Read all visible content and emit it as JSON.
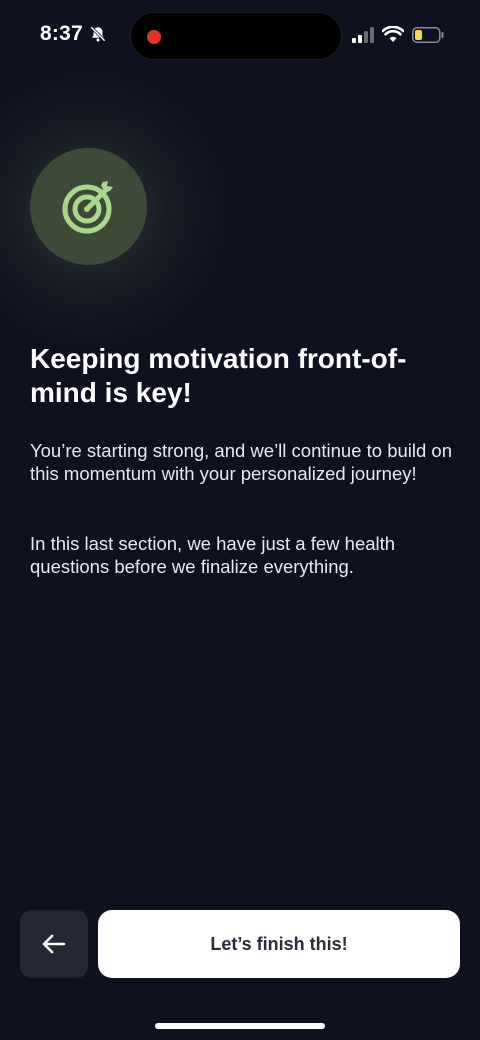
{
  "status_bar": {
    "time": "8:37",
    "icons": [
      "bell-slash-icon",
      "recording-dot-icon",
      "cellular-signal-icon",
      "wifi-icon",
      "battery-low-icon"
    ]
  },
  "hero": {
    "icon": "target-icon",
    "accent_color": "#a9d88c"
  },
  "content": {
    "headline": "Keeping motivation front-of-mind is key!",
    "paragraph_1": "You’re starting strong, and we’ll continue to build on this momentum with your personalized journey!",
    "paragraph_2": "In this last section, we have just a few health questions before we finalize everything."
  },
  "actions": {
    "back_icon": "arrow-left-icon",
    "primary_label": "Let’s finish this!"
  },
  "colors": {
    "background": "#0f1020",
    "button_bg": "#ffffff",
    "back_button_bg": "#262735"
  }
}
